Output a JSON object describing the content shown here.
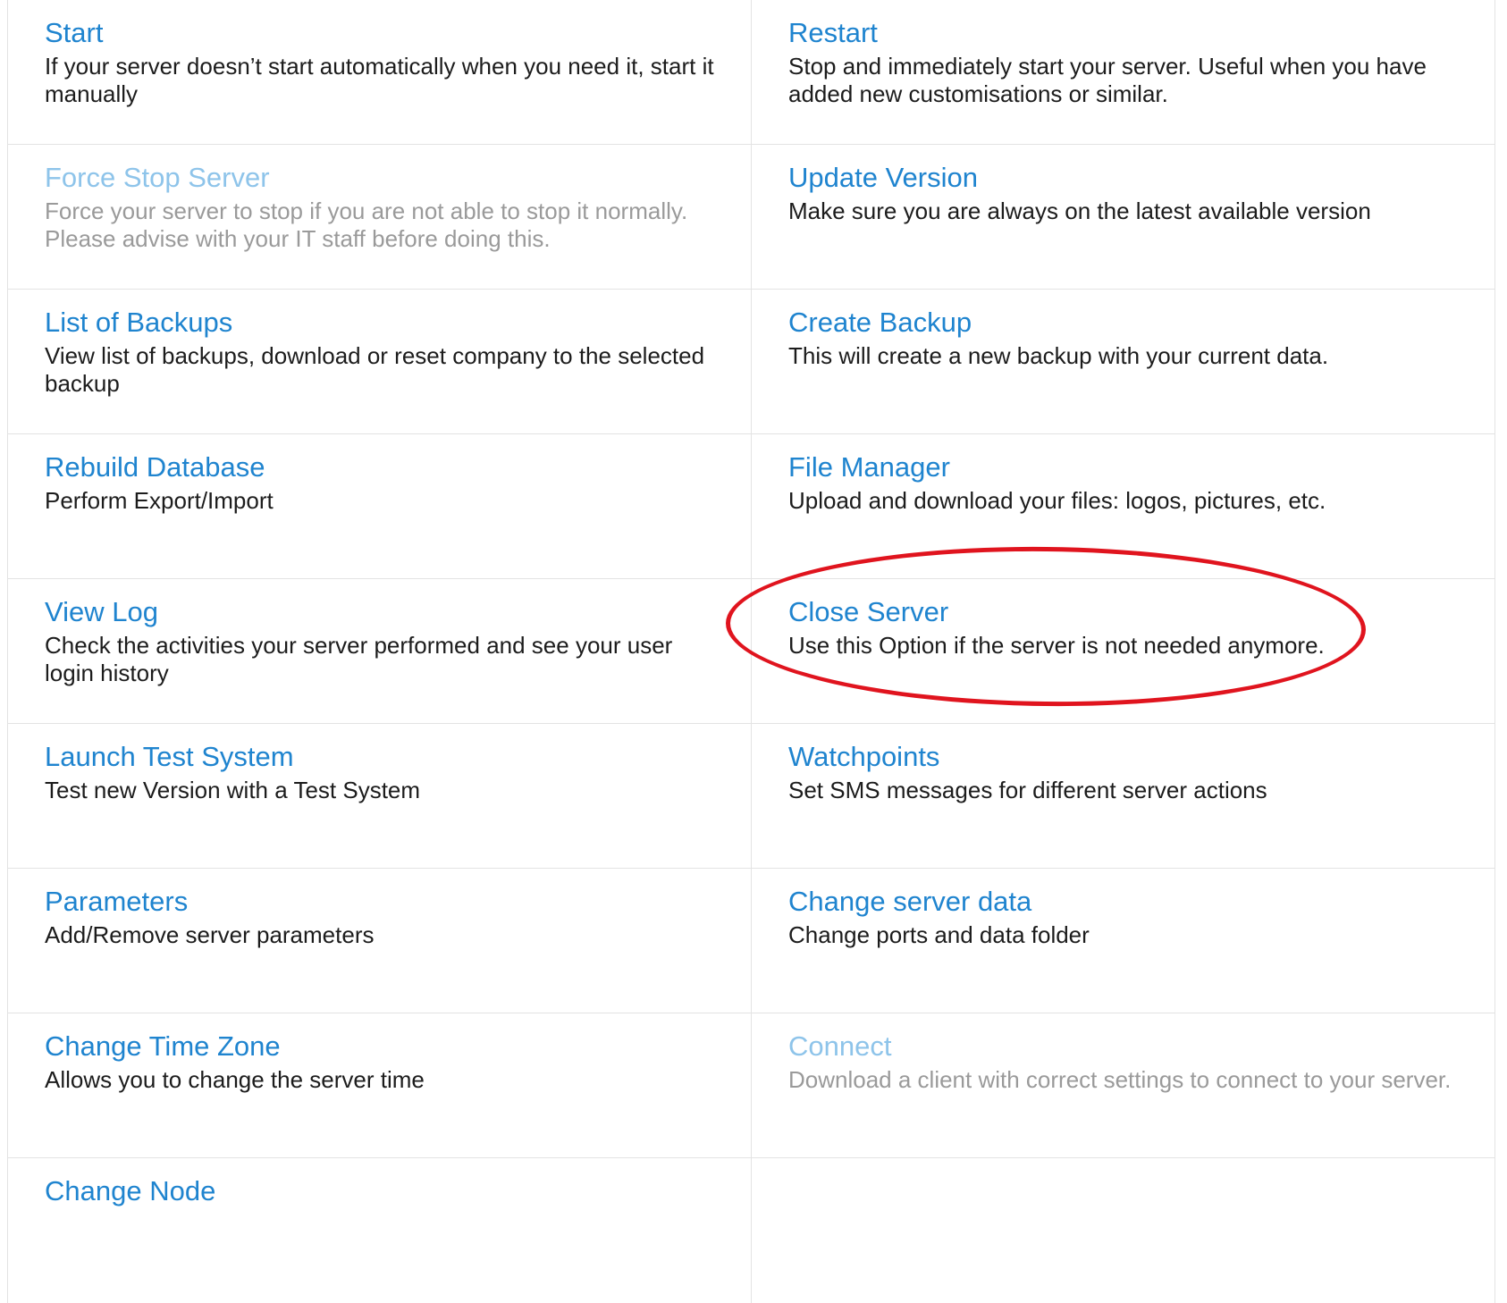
{
  "accent_color": "#1f84cf",
  "disabled_color": "#8ec4ea",
  "highlight_color": "#e0141e",
  "actions": [
    {
      "name": "start",
      "title": "Start",
      "description": "If your server doesn’t start automatically when you need it, start it manually",
      "enabled": true
    },
    {
      "name": "restart",
      "title": "Restart",
      "description": "Stop and immediately start your server. Useful when you have added new customisations or similar.",
      "enabled": true
    },
    {
      "name": "force-stop-server",
      "title": "Force Stop Server",
      "description": "Force your server to stop if you are not able to stop it normally. Please advise with your IT staff before doing this.",
      "enabled": false
    },
    {
      "name": "update-version",
      "title": "Update Version",
      "description": "Make sure you are always on the latest available version",
      "enabled": true
    },
    {
      "name": "list-of-backups",
      "title": "List of Backups",
      "description": "View list of backups, download or reset company to the selected backup",
      "enabled": true
    },
    {
      "name": "create-backup",
      "title": "Create Backup",
      "description": "This will create a new backup with your current data.",
      "enabled": true
    },
    {
      "name": "rebuild-database",
      "title": "Rebuild Database",
      "description": "Perform Export/Import",
      "enabled": true
    },
    {
      "name": "file-manager",
      "title": "File Manager",
      "description": "Upload and download your files: logos, pictures, etc.",
      "enabled": true
    },
    {
      "name": "view-log",
      "title": "View Log",
      "description": "Check the activities your server performed and see your user login history",
      "enabled": true
    },
    {
      "name": "close-server",
      "title": "Close Server",
      "description": "Use this Option if the server is not needed anymore.",
      "enabled": true,
      "highlighted": true
    },
    {
      "name": "launch-test-system",
      "title": "Launch Test System",
      "description": "Test new Version with a Test System",
      "enabled": true
    },
    {
      "name": "watchpoints",
      "title": "Watchpoints",
      "description": "Set SMS messages for different server actions",
      "enabled": true
    },
    {
      "name": "parameters",
      "title": "Parameters",
      "description": "Add/Remove server parameters",
      "enabled": true
    },
    {
      "name": "change-server-data",
      "title": "Change server data",
      "description": "Change ports and data folder",
      "enabled": true
    },
    {
      "name": "change-time-zone",
      "title": "Change Time Zone",
      "description": "Allows you to change the server time",
      "enabled": true
    },
    {
      "name": "connect",
      "title": "Connect",
      "description": "Download a client with correct settings to connect to your server.",
      "enabled": false
    },
    {
      "name": "change-node",
      "title": "Change Node",
      "description": "",
      "enabled": true
    }
  ]
}
